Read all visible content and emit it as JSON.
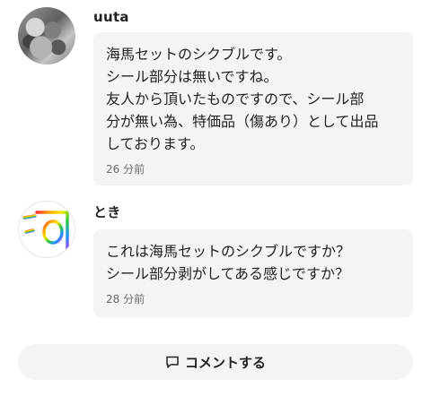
{
  "comments": [
    {
      "username": "uuta",
      "text": "海馬セットのシクブルです。\nシール部分は無いですね。\n友人から頂いたものですので、シール部\n分が無い為、特価品（傷あり）として出品\nしております。",
      "timestamp": "26 分前",
      "avatar": "gray-textured-photo-avatar"
    },
    {
      "username": "とき",
      "text": "これは海馬セットのシクブルですか？\nシール部分剥がしてある感じですか？",
      "timestamp": "28 分前",
      "avatar": "rainbow-glyph-avatar"
    }
  ],
  "comment_button": {
    "label": "コメントする",
    "icon": "speech-bubble-icon"
  }
}
